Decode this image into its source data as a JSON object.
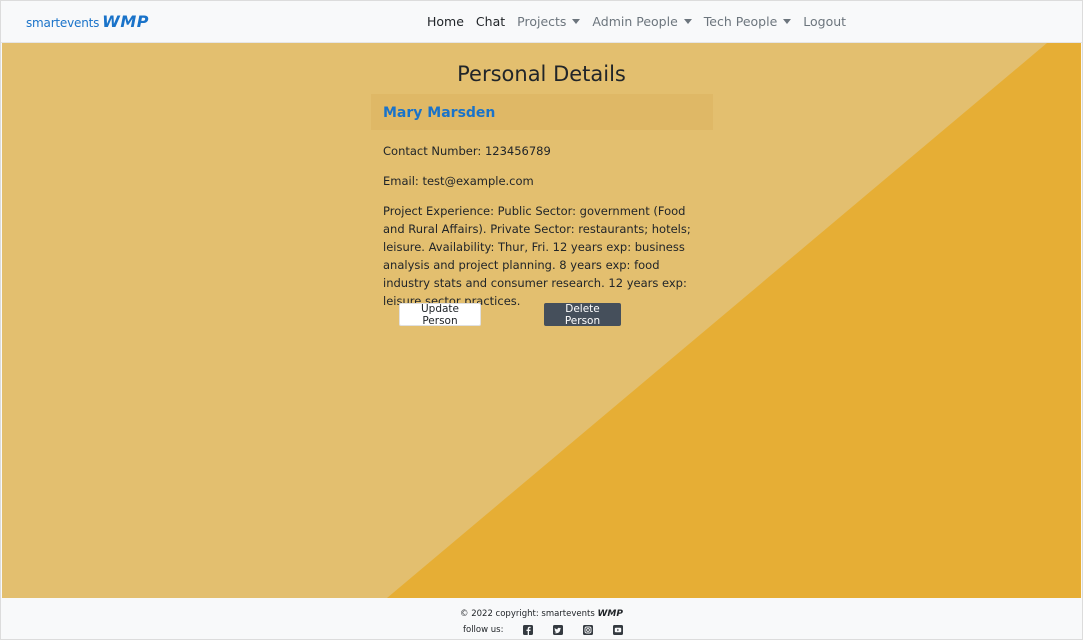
{
  "nav": {
    "brand_text": "smartevents",
    "brand_logo": "WMP",
    "items": [
      {
        "label": "Home",
        "dropdown": false,
        "active": true
      },
      {
        "label": "Chat",
        "dropdown": false,
        "active": true
      },
      {
        "label": "Projects",
        "dropdown": true,
        "active": false
      },
      {
        "label": "Admin People",
        "dropdown": true,
        "active": false
      },
      {
        "label": "Tech People",
        "dropdown": true,
        "active": false
      },
      {
        "label": "Logout",
        "dropdown": false,
        "active": false
      }
    ]
  },
  "page": {
    "title": "Personal Details",
    "person_name": "Mary Marsden",
    "details": [
      {
        "label": "Contact Number:",
        "value": "123456789"
      },
      {
        "label": "Email:",
        "value": "test@example.com"
      },
      {
        "label": "Project Experience:",
        "value": "Public Sector: government (Food and Rural Affairs). Private Sector: restaurants; hotels; leisure. Availability: Thur, Fri. 12 years exp: business analysis and project planning. 8 years exp: food industry stats and consumer research. 12 years exp: leisure sector practices."
      }
    ],
    "update_button": "Update Person",
    "delete_button": "Delete Person"
  },
  "footer": {
    "copyright": "© 2022 copyright: smartevents",
    "copyright_logo": "WMP",
    "follow_label": "follow us:",
    "social_icons": [
      "facebook-icon",
      "twitter-icon",
      "instagram-icon",
      "youtube-icon"
    ]
  },
  "colors": {
    "background_light": "#e3bf6f",
    "background_accent": "#e6ae35",
    "link_blue": "#1a73c9",
    "dark_button": "#454f5b"
  }
}
